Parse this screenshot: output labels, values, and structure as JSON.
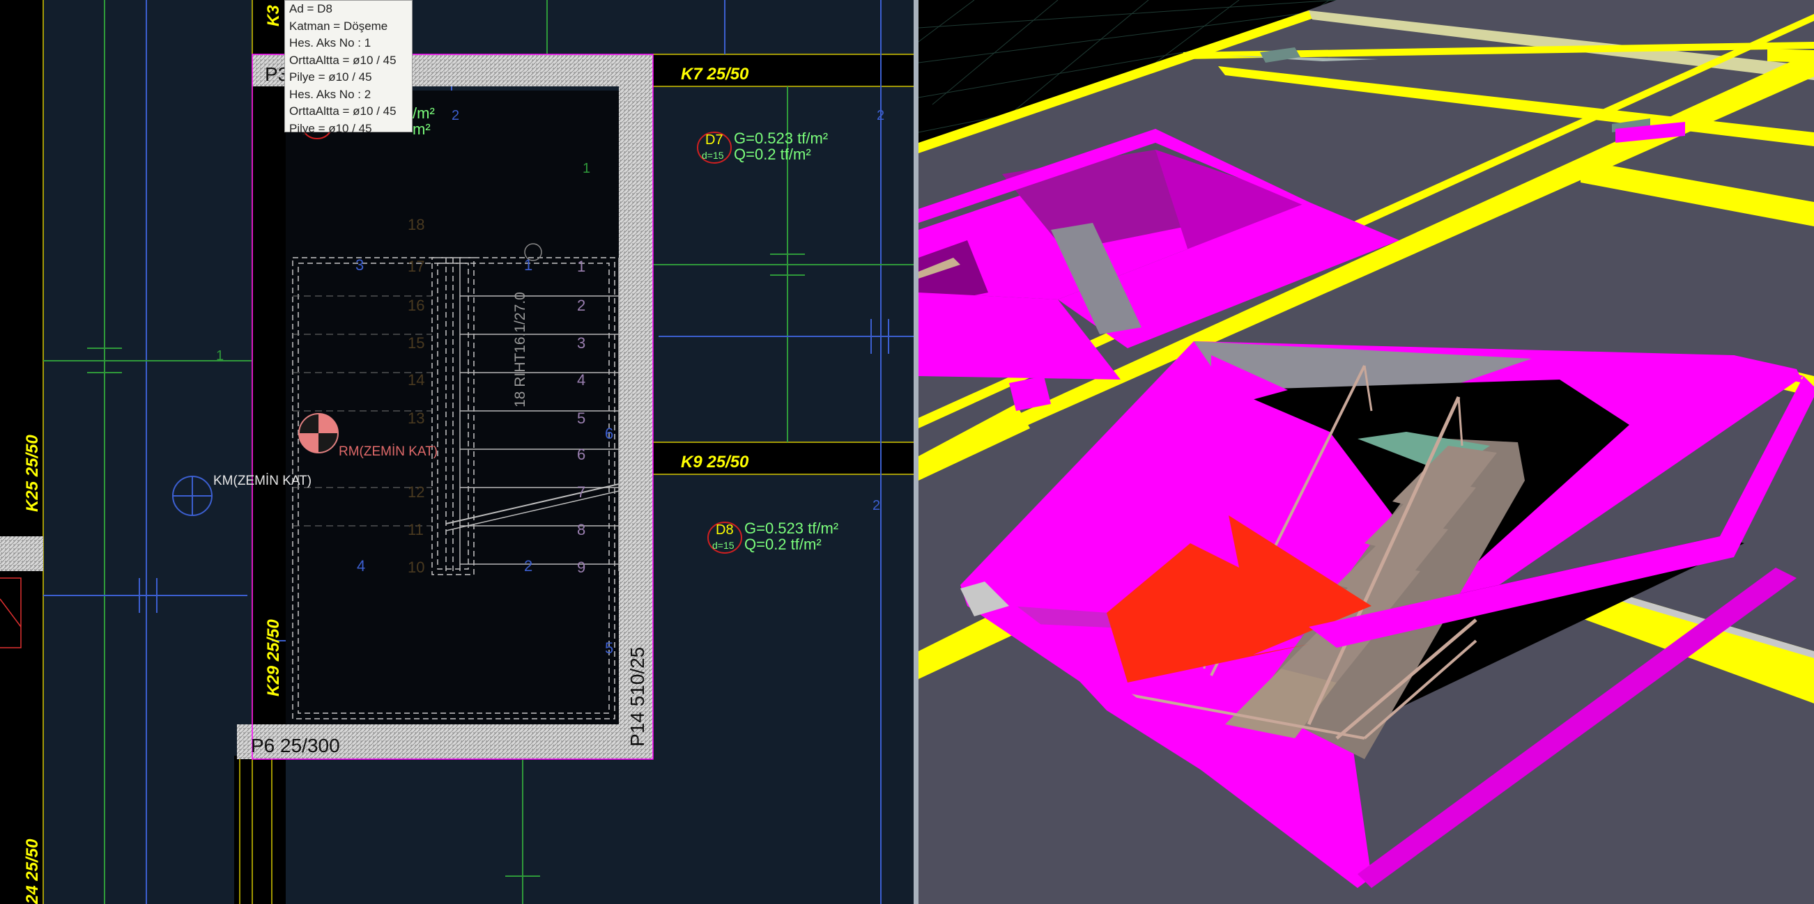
{
  "plan": {
    "beams": [
      {
        "id": "k7",
        "label": "K7 25/50"
      },
      {
        "id": "k9",
        "label": "K9 25/50"
      },
      {
        "id": "k25",
        "label": "K25 25/50"
      },
      {
        "id": "k29",
        "label": "K29 25/50"
      },
      {
        "id": "k24",
        "label": "24 25/50"
      },
      {
        "id": "k3",
        "label": "K3"
      }
    ],
    "columns": [
      {
        "id": "p6",
        "label": "P6 25/300"
      },
      {
        "id": "p14",
        "label": "P14 510/25"
      },
      {
        "id": "p3",
        "label": "P3"
      }
    ],
    "slabs": [
      {
        "id": "d7",
        "name": "D7",
        "thickness": "d=15",
        "g": "G=0.523 tf/m²",
        "q": "Q=0.2 tf/m²"
      },
      {
        "id": "d8",
        "name": "D8",
        "thickness": "d=15",
        "g": "G=0.523 tf/m²",
        "q": "Q=0.2 tf/m²"
      }
    ],
    "partial_slab_text": {
      "g": "/m²",
      "q": "m²"
    },
    "markers": {
      "km": "KM(ZEMİN KAT)",
      "rm": "RM(ZEMİN KAT)"
    },
    "stair_label": "18 RIHT16.1/27.0",
    "stair_steps": [
      "1",
      "2",
      "3",
      "4",
      "5",
      "6",
      "7",
      "8",
      "9"
    ],
    "left_stair_steps": [
      "18",
      "17",
      "16",
      "15",
      "14",
      "13",
      "12",
      "11",
      "10"
    ],
    "axis_numbers": {
      "one_a": "1",
      "one_b": "1",
      "two_a": "2",
      "two_b": "2",
      "two_c": "2"
    },
    "section_marks": [
      "3",
      "1",
      "4",
      "2",
      "5",
      "6"
    ]
  },
  "tooltip": {
    "lines": [
      "Ad = D8",
      "Katman = Döşeme",
      "Hes. Aks No : 1",
      "OrttaAltta = ø10 / 45",
      "Pilye = ø10 / 45",
      "Hes. Aks No : 2",
      "OrttaAltta = ø10 / 45",
      "Pilye = ø10 / 45"
    ]
  },
  "colors": {
    "background_plan": "#121e2c",
    "beam_band": "#000000",
    "beam_text": "#ffff00",
    "slab_text": "#7cff7c",
    "hatch": "#b8b8b8",
    "blue_line": "#3c5fd0",
    "green_line": "#2f9a3a",
    "beam_3d": "#ffff00",
    "opening_3d": "#ff00ff",
    "slab_3d": "#4f4f5e",
    "arrow_3d": "#ff2a10"
  }
}
